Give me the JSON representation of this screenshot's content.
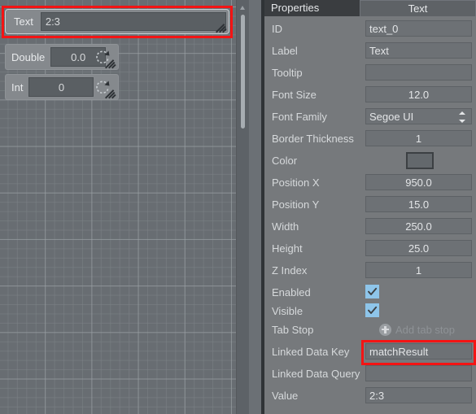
{
  "canvas": {
    "widgets": [
      {
        "name": "text-widget",
        "label": "Text",
        "value": "2:3",
        "selected": true,
        "handles": [
          "resize-grip"
        ]
      },
      {
        "name": "double-widget",
        "label": "Double",
        "value": "0.0",
        "selected": false,
        "handles": [
          "rotate-handle",
          "resize-grip"
        ]
      },
      {
        "name": "int-widget",
        "label": "Int",
        "value": "0",
        "selected": false,
        "handles": [
          "rotate-handle",
          "resize-grip"
        ]
      }
    ],
    "scrollbar": {
      "up_arrow": "triangle-up-icon"
    }
  },
  "panel": {
    "title": "Properties",
    "tab": "Text",
    "rows": [
      {
        "label": "ID",
        "type": "text",
        "value": "text_0",
        "align": "left"
      },
      {
        "label": "Label",
        "type": "text",
        "value": "Text",
        "align": "left"
      },
      {
        "label": "Tooltip",
        "type": "text",
        "value": "",
        "align": "left"
      },
      {
        "label": "Font Size",
        "type": "text",
        "value": "12.0",
        "align": "center"
      },
      {
        "label": "Font Family",
        "type": "select",
        "value": "Segoe UI"
      },
      {
        "label": "Border Thickness",
        "type": "text",
        "value": "1",
        "align": "center"
      },
      {
        "label": "Color",
        "type": "color",
        "value": "#63686c"
      },
      {
        "label": "Position X",
        "type": "text",
        "value": "950.0",
        "align": "center"
      },
      {
        "label": "Position Y",
        "type": "text",
        "value": "15.0",
        "align": "center"
      },
      {
        "label": "Width",
        "type": "text",
        "value": "250.0",
        "align": "center"
      },
      {
        "label": "Height",
        "type": "text",
        "value": "25.0",
        "align": "center"
      },
      {
        "label": "Z Index",
        "type": "text",
        "value": "1",
        "align": "center"
      },
      {
        "label": "Enabled",
        "type": "checkbox",
        "value": true
      },
      {
        "label": "Visible",
        "type": "checkbox",
        "value": true
      },
      {
        "label": "Tab Stop",
        "type": "action",
        "value": "Add tab stop"
      },
      {
        "label": "Linked Data Key",
        "type": "text",
        "value": "matchResult",
        "align": "left",
        "highlighted": true
      },
      {
        "label": "Linked Data Query",
        "type": "text",
        "value": "",
        "align": "left"
      },
      {
        "label": "Value",
        "type": "text",
        "value": "2:3",
        "align": "left"
      }
    ]
  },
  "annotations": {
    "highlight_color": "#f41414",
    "boxes": [
      "text-widget",
      "linked-data-key-field"
    ]
  }
}
